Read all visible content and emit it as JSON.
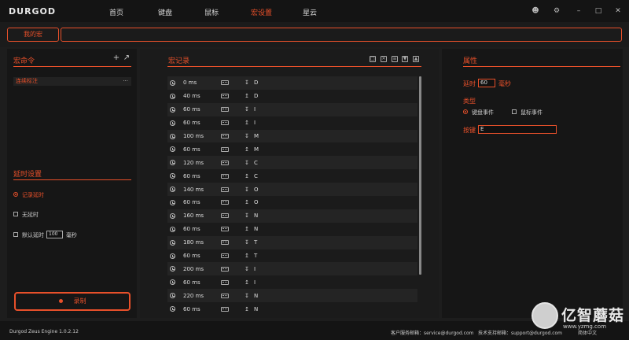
{
  "app": {
    "logo": "DURGOD"
  },
  "nav": [
    {
      "label": "首页",
      "active": false
    },
    {
      "label": "键盘",
      "active": false
    },
    {
      "label": "鼠标",
      "active": false
    },
    {
      "label": "宏设置",
      "active": true
    },
    {
      "label": "星云",
      "active": false
    }
  ],
  "window": {
    "user_icon": "user-icon",
    "settings_icon": "gear-icon",
    "minimize_icon": "minimize-icon",
    "maximize_icon": "maximize-icon",
    "close_icon": "close-icon"
  },
  "macro_bar": {
    "tab_label": "我的宏",
    "name_value": ""
  },
  "left": {
    "title": "宏命令",
    "add_icon": "+",
    "items": [
      {
        "label": "连续标注",
        "more": "···"
      }
    ],
    "delay_title": "延时设置",
    "options": [
      {
        "label": "记录延时",
        "checked": true
      },
      {
        "label": "无延时",
        "checked": false
      },
      {
        "label": "默认延时",
        "checked": false
      }
    ],
    "default_delay_value": "100",
    "default_delay_unit": "毫秒",
    "record_label": "录制"
  },
  "center": {
    "title": "宏记录",
    "records": [
      {
        "ms": "0 ms",
        "dir": "down",
        "key": "D"
      },
      {
        "ms": "40 ms",
        "dir": "up",
        "key": "D"
      },
      {
        "ms": "60 ms",
        "dir": "down",
        "key": "I"
      },
      {
        "ms": "60 ms",
        "dir": "up",
        "key": "I"
      },
      {
        "ms": "100 ms",
        "dir": "down",
        "key": "M"
      },
      {
        "ms": "60 ms",
        "dir": "up",
        "key": "M"
      },
      {
        "ms": "120 ms",
        "dir": "down",
        "key": "C"
      },
      {
        "ms": "60 ms",
        "dir": "up",
        "key": "C"
      },
      {
        "ms": "140 ms",
        "dir": "down",
        "key": "O"
      },
      {
        "ms": "60 ms",
        "dir": "up",
        "key": "O"
      },
      {
        "ms": "160 ms",
        "dir": "down",
        "key": "N"
      },
      {
        "ms": "60 ms",
        "dir": "up",
        "key": "N"
      },
      {
        "ms": "180 ms",
        "dir": "down",
        "key": "T"
      },
      {
        "ms": "60 ms",
        "dir": "up",
        "key": "T"
      },
      {
        "ms": "200 ms",
        "dir": "down",
        "key": "I"
      },
      {
        "ms": "60 ms",
        "dir": "up",
        "key": "I"
      },
      {
        "ms": "220 ms",
        "dir": "down",
        "key": "N"
      },
      {
        "ms": "60 ms",
        "dir": "up",
        "key": "N"
      }
    ]
  },
  "right": {
    "title": "属性",
    "delay_label": "延时",
    "delay_value": "60",
    "delay_unit": "毫秒",
    "type_label": "类型",
    "type_options": [
      {
        "label": "键盘事件",
        "checked": true
      },
      {
        "label": "鼠标事件",
        "checked": false
      }
    ],
    "key_label": "按键",
    "key_value": "E"
  },
  "footer": {
    "version": "Durgod Zeus Engine 1.0.2.12",
    "service_label": "客户服务邮箱：service@durgod.com",
    "support_label": "技术支持邮箱：support@durgod.com",
    "language": "简体中文"
  },
  "watermark": {
    "text": "亿智蘑菇",
    "url": "www.yzmg.com"
  },
  "colors": {
    "accent": "#e8502a",
    "background": "#1d1d1d"
  }
}
